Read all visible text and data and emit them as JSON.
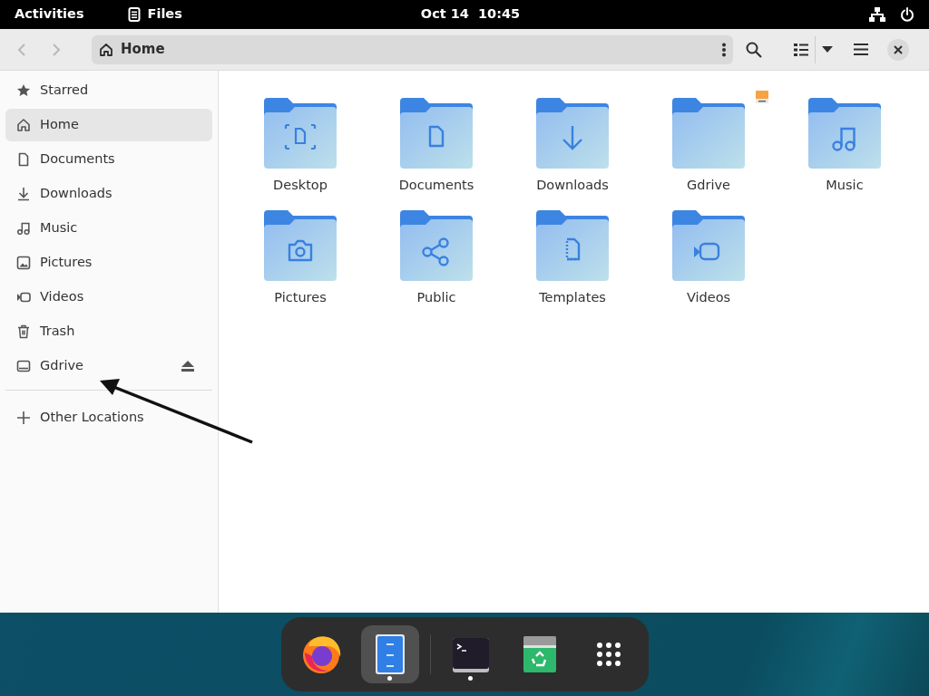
{
  "top_bar": {
    "activities": "Activities",
    "app_name": "Files",
    "clock": "Oct 14  10:45"
  },
  "header": {
    "location": "Home"
  },
  "sidebar": {
    "items": [
      {
        "label": "Starred",
        "kind": "star",
        "selected": false
      },
      {
        "label": "Home",
        "kind": "home",
        "selected": true
      },
      {
        "label": "Documents",
        "kind": "document",
        "selected": false
      },
      {
        "label": "Downloads",
        "kind": "download",
        "selected": false
      },
      {
        "label": "Music",
        "kind": "music",
        "selected": false
      },
      {
        "label": "Pictures",
        "kind": "picture",
        "selected": false
      },
      {
        "label": "Videos",
        "kind": "video",
        "selected": false
      },
      {
        "label": "Trash",
        "kind": "trash",
        "selected": false
      },
      {
        "label": "Gdrive",
        "kind": "drive",
        "selected": false,
        "ejectable": true
      }
    ],
    "other": {
      "label": "Other Locations"
    }
  },
  "folders": [
    {
      "label": "Desktop",
      "kind": "desktop"
    },
    {
      "label": "Documents",
      "kind": "documents"
    },
    {
      "label": "Downloads",
      "kind": "downloads"
    },
    {
      "label": "Gdrive",
      "kind": "plain",
      "mounted": true
    },
    {
      "label": "Music",
      "kind": "music"
    },
    {
      "label": "Pictures",
      "kind": "pictures"
    },
    {
      "label": "Public",
      "kind": "public"
    },
    {
      "label": "Templates",
      "kind": "templates"
    },
    {
      "label": "Videos",
      "kind": "videos"
    }
  ],
  "dock": [
    {
      "kind": "firefox",
      "running": false,
      "selected": false
    },
    {
      "kind": "files",
      "running": true,
      "selected": true
    },
    {
      "kind": "separator"
    },
    {
      "kind": "terminal",
      "running": true,
      "selected": false
    },
    {
      "kind": "recycle",
      "running": false,
      "selected": false
    },
    {
      "kind": "apps",
      "running": false,
      "selected": false
    }
  ]
}
